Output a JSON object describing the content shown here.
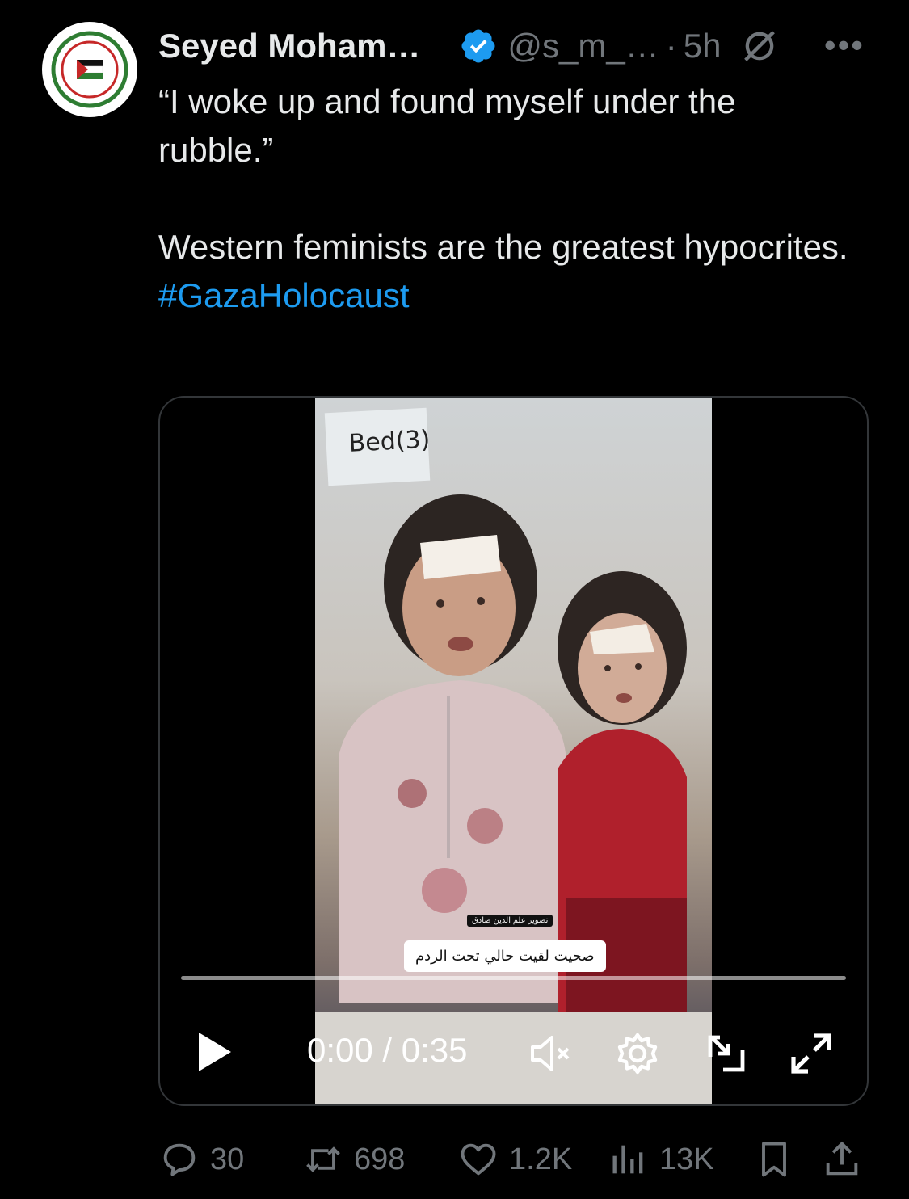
{
  "tweet": {
    "author_name": "Seyed Moham…",
    "handle": "@s_m_…",
    "separator": "·",
    "time": "5h",
    "more": "•••",
    "text_line1": "“I woke up and found myself under the rubble.”",
    "text_line2": "Western feminists are the greatest hypocrites.",
    "hashtag": "#GazaHolocaust"
  },
  "video": {
    "bed_label": "Bed(3)",
    "credit_text": "تصوير علم الدين صادق",
    "subtitle_text": "صحيت لقيت حالي تحت الردم",
    "timecode": "0:00 / 0:35",
    "progress": 0
  },
  "actions": {
    "replies": "30",
    "reposts": "698",
    "likes": "1.2K",
    "views": "13K"
  },
  "colors": {
    "background": "#000000",
    "text": "#e7e9ea",
    "muted": "#71767b",
    "accent": "#1d9bf0"
  },
  "icons": [
    "save-gaza-avatar",
    "verified-badge-icon",
    "no-sign-icon",
    "more-icon",
    "play-icon",
    "mute-icon",
    "settings-icon",
    "minimize-icon",
    "fullscreen-icon",
    "reply-icon",
    "repost-icon",
    "like-icon",
    "views-icon",
    "bookmark-icon",
    "share-icon"
  ]
}
